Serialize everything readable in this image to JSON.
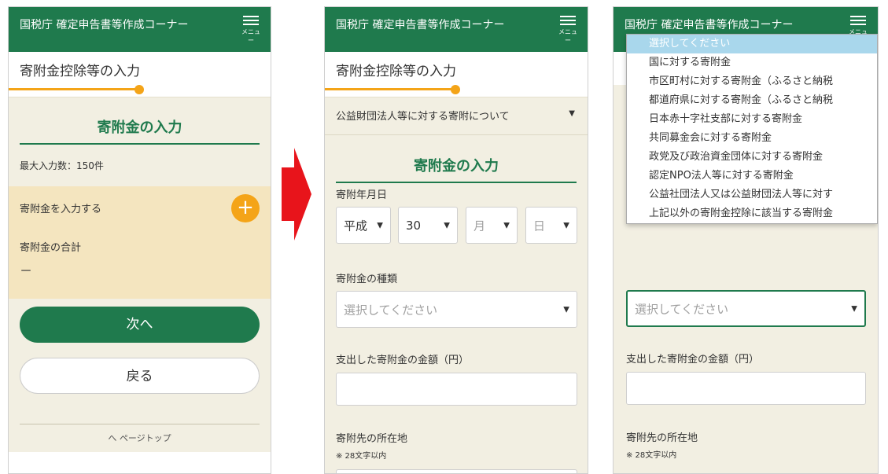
{
  "header": {
    "title": "国税庁 確定申告書等作成コーナー",
    "menu_label": "メニュー"
  },
  "page_title": "寄附金控除等の入力",
  "screen1": {
    "section_title": "寄附金の入力",
    "max_entries": "最大入力数：150件",
    "add_label": "寄附金を入力する",
    "total_label": "寄附金の合計",
    "total_value": "－",
    "next_button": "次へ",
    "back_button": "戻る",
    "page_top": "へ ページトップ",
    "footer_text_left": "…",
    "footer_text_right": "…"
  },
  "screen2": {
    "category_select": "公益財団法人等に対する寄附について",
    "section_title": "寄附金の入力",
    "date_label": "寄附年月日",
    "era_value": "平成",
    "year_value": "30",
    "month_placeholder": "月",
    "day_placeholder": "日",
    "type_label": "寄附金の種類",
    "type_placeholder": "選択してください",
    "amount_label": "支出した寄附金の金額（円）",
    "location_label": "寄附先の所在地",
    "location_note": "※ 28文字以内"
  },
  "screen3": {
    "dropdown_options": [
      "選択してください",
      "国に対する寄附金",
      "市区町村に対する寄附金（ふるさと納税",
      "都道府県に対する寄附金（ふるさと納税",
      "日本赤十字社支部に対する寄附金",
      "共同募金会に対する寄附金",
      "政党及び政治資金団体に対する寄附金",
      "認定NPO法人等に対する寄附金",
      "公益社団法人又は公益財団法人等に対す",
      "上記以外の寄附金控除に該当する寄附金"
    ],
    "selected_option_index": 0,
    "type_placeholder": "選択してください",
    "amount_label": "支出した寄附金の金額（円）",
    "location_label": "寄附先の所在地",
    "location_note": "※ 28文字以内"
  },
  "colors": {
    "header_green": "#1f7a4d",
    "accent_orange": "#f4a418",
    "arrow_red": "#e8141b",
    "add_box": "#f4e5bf",
    "page_bg": "#f2efe2"
  },
  "icons": {
    "menu": "hamburger-icon",
    "add": "plus-icon",
    "caret": "caret-down-icon",
    "page_top": "chevron-up-icon",
    "transition": "right-arrow-icon"
  }
}
